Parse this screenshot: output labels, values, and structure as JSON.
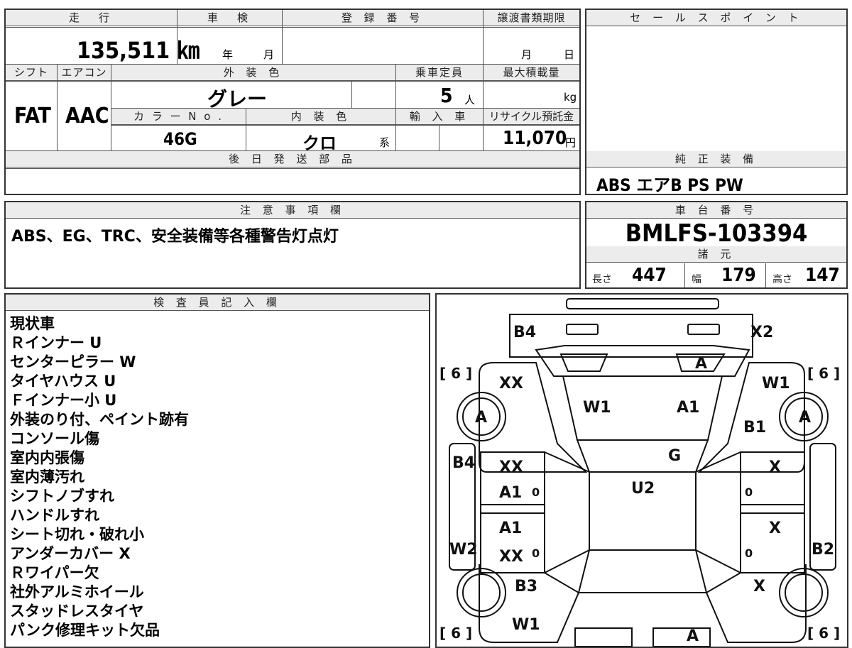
{
  "top_table": {
    "mileage_label": "走　行",
    "mileage_value": "135,511 ㎞",
    "inspection_label": "車　検",
    "inspection_year": "年",
    "inspection_month": "月",
    "registration_label": "登 録 番 号",
    "transfer_label": "譲渡書類期限",
    "transfer_month": "月",
    "transfer_day": "日",
    "shift_label": "シフト",
    "shift_value": "FAT",
    "aircon_label": "エアコン",
    "aircon_value": "AAC",
    "exterior_color_label": "外 装 色",
    "exterior_color_value": "グレー",
    "capacity_label": "乗車定員",
    "capacity_value": "5",
    "capacity_unit": "人",
    "max_load_label": "最大積載量",
    "max_load_unit": "kg",
    "color_no_label": "カ ラ ー N o .",
    "color_no_value": "46G",
    "interior_label": "内 装 色",
    "interior_value": "クロ",
    "interior_suffix": "系",
    "import_label": "輸 入 車",
    "recycle_label": "リサイクル預託金",
    "recycle_value": "11,070",
    "recycle_unit": "円",
    "later_parts_label": "後 日 発 送 部 品"
  },
  "sales_point": {
    "label": "セ ー ル ス ポ イ ン ト"
  },
  "genuine_equipment": {
    "label": "純 正 装 備",
    "value": "ABS エアB PS PW"
  },
  "notes": {
    "label": "注 意 事 項 欄",
    "value": "ABS、EG、TRC、安全装備等各種警告灯点灯"
  },
  "chassis": {
    "label": "車 台 番 号",
    "value": "BMLFS-103394"
  },
  "specs": {
    "label": "諸 元",
    "length_label": "長さ",
    "length_value": "447",
    "width_label": "幅",
    "width_value": "179",
    "height_label": "高さ",
    "height_value": "147"
  },
  "inspector": {
    "label": "検 査 員 記 入 欄",
    "remarks": [
      "現状車",
      "Ｒインナー U",
      "センターピラー W",
      "タイヤハウス U",
      "Ｆインナー小 U",
      "外装のり付、ペイント跡有",
      "コンソール傷",
      "室内内張傷",
      "室内薄汚れ",
      "シフトノブすれ",
      "ハンドルすれ",
      "シート切れ・破れ小",
      "アンダーカバー X",
      "Ｒワイパー欠",
      "社外アルミホイール",
      "スタッドレスタイヤ",
      "パンク修理キット欠品"
    ]
  },
  "diagram": {
    "marks": {
      "rear_left": "B4",
      "rear_right": "X2",
      "rear_glass": "A",
      "tread_fl": "[ 6 ]",
      "tread_fr": "[ 6 ]",
      "tread_rl": "[ 6 ]",
      "tread_rr": "[ 6 ]",
      "quarter_left": "XX",
      "quarter_right": "W1",
      "roof_left": "W1",
      "roof_right": "A1",
      "wheel_rl": "A",
      "wheel_rr": "A",
      "pillar_right": "B1",
      "roof_g": "G",
      "step_left": "B4",
      "door_rl_1": "XX",
      "door_rl_2": "A1",
      "door_rl_zero": "0",
      "door_rr": "X",
      "door_rr_zero": "0",
      "center": "U2",
      "door_fl_1": "A1",
      "door_fl_2": "XX",
      "door_fl_zero": "0",
      "door_fr": "X",
      "door_fr_zero": "0",
      "step_left_front": "W2",
      "step_right_front": "B2",
      "fender_left": "B3",
      "fender_right": "X",
      "front_left": "W1",
      "front_a": "A"
    }
  }
}
